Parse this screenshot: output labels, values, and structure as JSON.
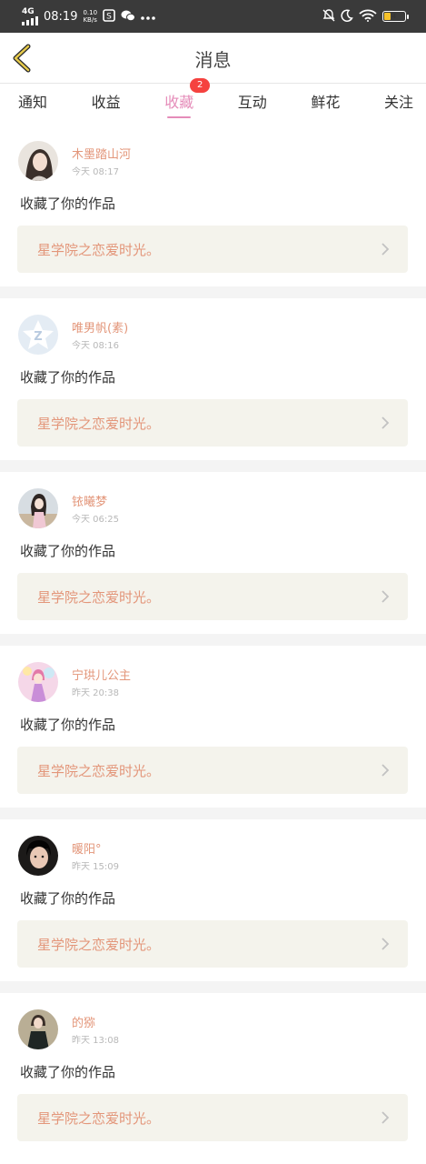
{
  "status_bar": {
    "network": "4G",
    "time": "08:19",
    "speed_value": "0.10",
    "speed_unit": "KB/s",
    "battery": "4",
    "colors": {
      "background": "#3a3a3a",
      "battery_fill": "#f6c22b"
    },
    "icons": [
      "signal-icon",
      "notification-app-icon",
      "wechat-icon",
      "more-dots-icon",
      "mute-bell-icon",
      "moon-icon",
      "wifi-icon",
      "battery-icon"
    ]
  },
  "header": {
    "title": "消息",
    "back_icon": "chevron-left-icon"
  },
  "tabs": [
    {
      "label": "通知"
    },
    {
      "label": "收益"
    },
    {
      "label": "收藏",
      "active": true,
      "badge": "2"
    },
    {
      "label": "互动"
    },
    {
      "label": "鲜花"
    },
    {
      "label": "关注"
    }
  ],
  "colors": {
    "accent": "#e58cb9",
    "name_text": "#e3967a",
    "badge": "#f5423f",
    "box_bg": "#f4f3ec"
  },
  "notifications": [
    {
      "name": "木墨踏山河",
      "time": "今天 08:17",
      "action": "收藏了你的作品",
      "work": "星学院之恋爱时光。"
    },
    {
      "name": "唯男帆(素)",
      "time": "今天 08:16",
      "action": "收藏了你的作品",
      "work": "星学院之恋爱时光。"
    },
    {
      "name": "铱曦梦",
      "time": "今天 06:25",
      "action": "收藏了你的作品",
      "work": "星学院之恋爱时光。"
    },
    {
      "name": "宁珙儿公主",
      "time": "昨天 20:38",
      "action": "收藏了你的作品",
      "work": "星学院之恋爱时光。"
    },
    {
      "name": "暖阳°",
      "time": "昨天 15:09",
      "action": "收藏了你的作品",
      "work": "星学院之恋爱时光。"
    },
    {
      "name": "的猕",
      "time": "昨天 13:08",
      "action": "收藏了你的作品",
      "work": "星学院之恋爱时光。"
    }
  ]
}
